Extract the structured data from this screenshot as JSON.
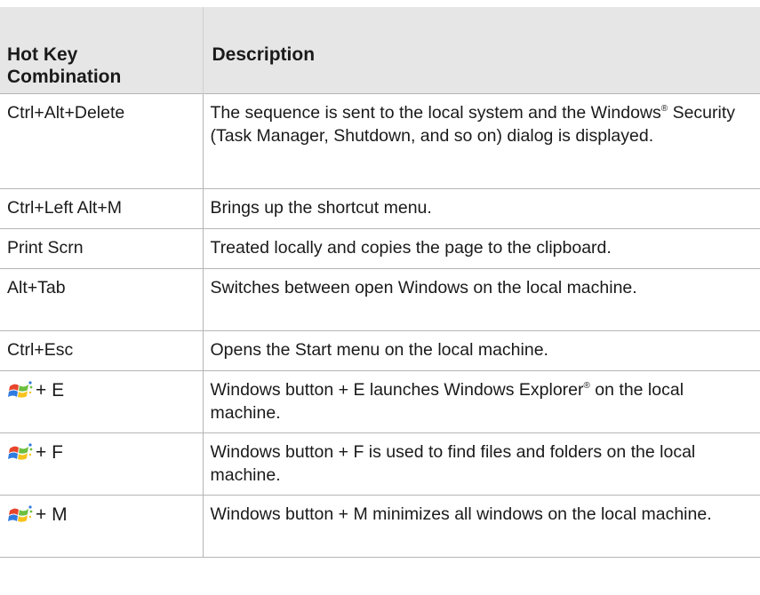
{
  "table": {
    "headers": [
      "Hot Key Combination",
      "Description"
    ],
    "header_key_line1": "Hot Key",
    "header_key_line2": "Combination",
    "header_desc": "Description",
    "rows": [
      {
        "key": "Ctrl+Alt+Delete",
        "desc_a": "The sequence is sent to the local system and the Windows",
        "desc_b": " Security (Task Manager, Shutdown, and so on) dialog is displayed."
      },
      {
        "key": "Ctrl+Left Alt+M",
        "desc": "Brings up the shortcut menu."
      },
      {
        "key": "Print Scrn",
        "desc": "Treated locally and copies the page to the clipboard."
      },
      {
        "key": "Alt+Tab",
        "desc": "Switches between open Windows on the local machine."
      },
      {
        "key": "Ctrl+Esc",
        "desc": "Opens the Start menu on the local machine."
      },
      {
        "key_icon": "windows-logo-icon",
        "key_suffix": "+ E",
        "desc_a": "Windows button + E launches Windows Explorer",
        "desc_b": " on the local machine."
      },
      {
        "key_icon": "windows-logo-icon",
        "key_suffix": "+ F",
        "desc": "Windows button + F is used to find files and folders on the local machine."
      },
      {
        "key_icon": "windows-logo-icon",
        "key_suffix": "+ M",
        "desc": "Windows button + M minimizes all windows on the local machine."
      }
    ],
    "registered_mark": "®"
  }
}
